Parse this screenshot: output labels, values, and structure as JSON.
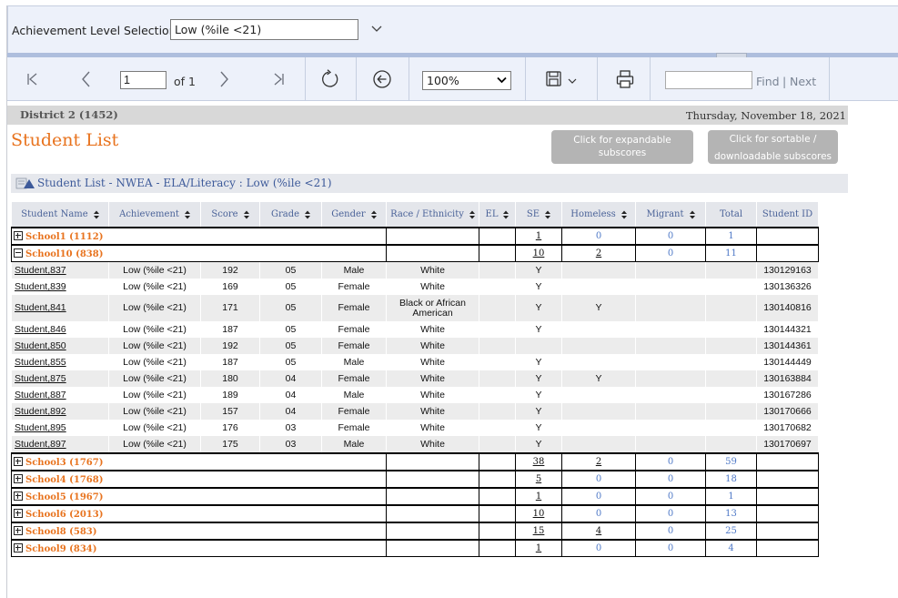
{
  "parameters": {
    "achievement_label": "Achievement Level Selection",
    "achievement_value": "Low (%ile <21)"
  },
  "toolbar": {
    "page_value": "1",
    "of_label": "of 1",
    "zoom_value": "100%",
    "find_label": "Find",
    "separator": "|",
    "next_label": "Next"
  },
  "report": {
    "district": "District 2 (1452)",
    "date": "Thursday, November 18, 2021",
    "title": "Student List",
    "expand_button": "Click for expandable subscores",
    "sort_button": "Click for sortable / downloadable subscores",
    "subtitle": "Student List - NWEA - ELA/Literacy : Low (%ile <21)"
  },
  "table": {
    "headers": [
      "Student Name",
      "Achievement",
      "Score",
      "Grade",
      "Gender",
      "Race / Ethnicity",
      "EL",
      "SE",
      "Homeless",
      "Migrant",
      "Total",
      "Student ID"
    ],
    "sortable": [
      true,
      true,
      true,
      true,
      true,
      true,
      true,
      true,
      true,
      true,
      false,
      false
    ],
    "rows": [
      {
        "type": "school",
        "name": "School1 (1112)",
        "expanded": false,
        "se": "1",
        "homeless": "0",
        "migrant": "0",
        "total": "1"
      },
      {
        "type": "school",
        "name": "School10 (838)",
        "expanded": true,
        "se": "10",
        "homeless": "2",
        "migrant": "0",
        "total": "11"
      },
      {
        "type": "student",
        "name": "Student,837",
        "achievement": "Low (%ile <21)",
        "score": "192",
        "grade": "05",
        "gender": "Male",
        "race": "White",
        "el": "",
        "se": "Y",
        "homeless": "",
        "migrant": "",
        "total": "",
        "id": "130129163"
      },
      {
        "type": "student",
        "name": "Student,839",
        "achievement": "Low (%ile <21)",
        "score": "169",
        "grade": "05",
        "gender": "Female",
        "race": "White",
        "el": "",
        "se": "Y",
        "homeless": "",
        "migrant": "",
        "total": "",
        "id": "130136326"
      },
      {
        "type": "student",
        "name": "Student,841",
        "achievement": "Low (%ile <21)",
        "score": "171",
        "grade": "05",
        "gender": "Female",
        "race": "Black or African American",
        "el": "",
        "se": "Y",
        "homeless": "Y",
        "migrant": "",
        "total": "",
        "id": "130140816"
      },
      {
        "type": "student",
        "name": "Student,846",
        "achievement": "Low (%ile <21)",
        "score": "187",
        "grade": "05",
        "gender": "Female",
        "race": "White",
        "el": "",
        "se": "Y",
        "homeless": "",
        "migrant": "",
        "total": "",
        "id": "130144321"
      },
      {
        "type": "student",
        "name": "Student,850",
        "achievement": "Low (%ile <21)",
        "score": "192",
        "grade": "05",
        "gender": "Female",
        "race": "White",
        "el": "",
        "se": "",
        "homeless": "",
        "migrant": "",
        "total": "",
        "id": "130144361"
      },
      {
        "type": "student",
        "name": "Student,855",
        "achievement": "Low (%ile <21)",
        "score": "187",
        "grade": "05",
        "gender": "Male",
        "race": "White",
        "el": "",
        "se": "Y",
        "homeless": "",
        "migrant": "",
        "total": "",
        "id": "130144449"
      },
      {
        "type": "student",
        "name": "Student,875",
        "achievement": "Low (%ile <21)",
        "score": "180",
        "grade": "04",
        "gender": "Female",
        "race": "White",
        "el": "",
        "se": "Y",
        "homeless": "Y",
        "migrant": "",
        "total": "",
        "id": "130163884"
      },
      {
        "type": "student",
        "name": "Student,887",
        "achievement": "Low (%ile <21)",
        "score": "189",
        "grade": "04",
        "gender": "Male",
        "race": "White",
        "el": "",
        "se": "Y",
        "homeless": "",
        "migrant": "",
        "total": "",
        "id": "130167286"
      },
      {
        "type": "student",
        "name": "Student,892",
        "achievement": "Low (%ile <21)",
        "score": "157",
        "grade": "04",
        "gender": "Female",
        "race": "White",
        "el": "",
        "se": "Y",
        "homeless": "",
        "migrant": "",
        "total": "",
        "id": "130170666"
      },
      {
        "type": "student",
        "name": "Student,895",
        "achievement": "Low (%ile <21)",
        "score": "176",
        "grade": "03",
        "gender": "Female",
        "race": "White",
        "el": "",
        "se": "Y",
        "homeless": "",
        "migrant": "",
        "total": "",
        "id": "130170682"
      },
      {
        "type": "student",
        "name": "Student,897",
        "achievement": "Low (%ile <21)",
        "score": "175",
        "grade": "03",
        "gender": "Male",
        "race": "White",
        "el": "",
        "se": "Y",
        "homeless": "",
        "migrant": "",
        "total": "",
        "id": "130170697"
      },
      {
        "type": "school",
        "name": "School3 (1767)",
        "expanded": false,
        "se": "38",
        "homeless": "2",
        "migrant": "0",
        "total": "59"
      },
      {
        "type": "school",
        "name": "School4 (1768)",
        "expanded": false,
        "se": "5",
        "homeless": "0",
        "migrant": "0",
        "total": "18"
      },
      {
        "type": "school",
        "name": "School5 (1967)",
        "expanded": false,
        "se": "1",
        "homeless": "0",
        "migrant": "0",
        "total": "1"
      },
      {
        "type": "school",
        "name": "School6 (2013)",
        "expanded": false,
        "se": "10",
        "homeless": "0",
        "migrant": "0",
        "total": "13"
      },
      {
        "type": "school",
        "name": "School8 (583)",
        "expanded": false,
        "se": "15",
        "homeless": "4",
        "migrant": "0",
        "total": "25"
      },
      {
        "type": "school",
        "name": "School9 (834)",
        "expanded": false,
        "se": "1",
        "homeless": "0",
        "migrant": "0",
        "total": "4"
      }
    ]
  },
  "colors": {
    "accent": "#e8731e",
    "link_blue": "#4f79c7",
    "header_text": "#4a6298",
    "toolbar_bg": "#edf1fa"
  },
  "icons": [
    "first-page-icon",
    "previous-page-icon",
    "next-page-icon",
    "last-page-icon",
    "refresh-icon",
    "back-icon",
    "save-icon",
    "print-icon",
    "report-icon"
  ]
}
